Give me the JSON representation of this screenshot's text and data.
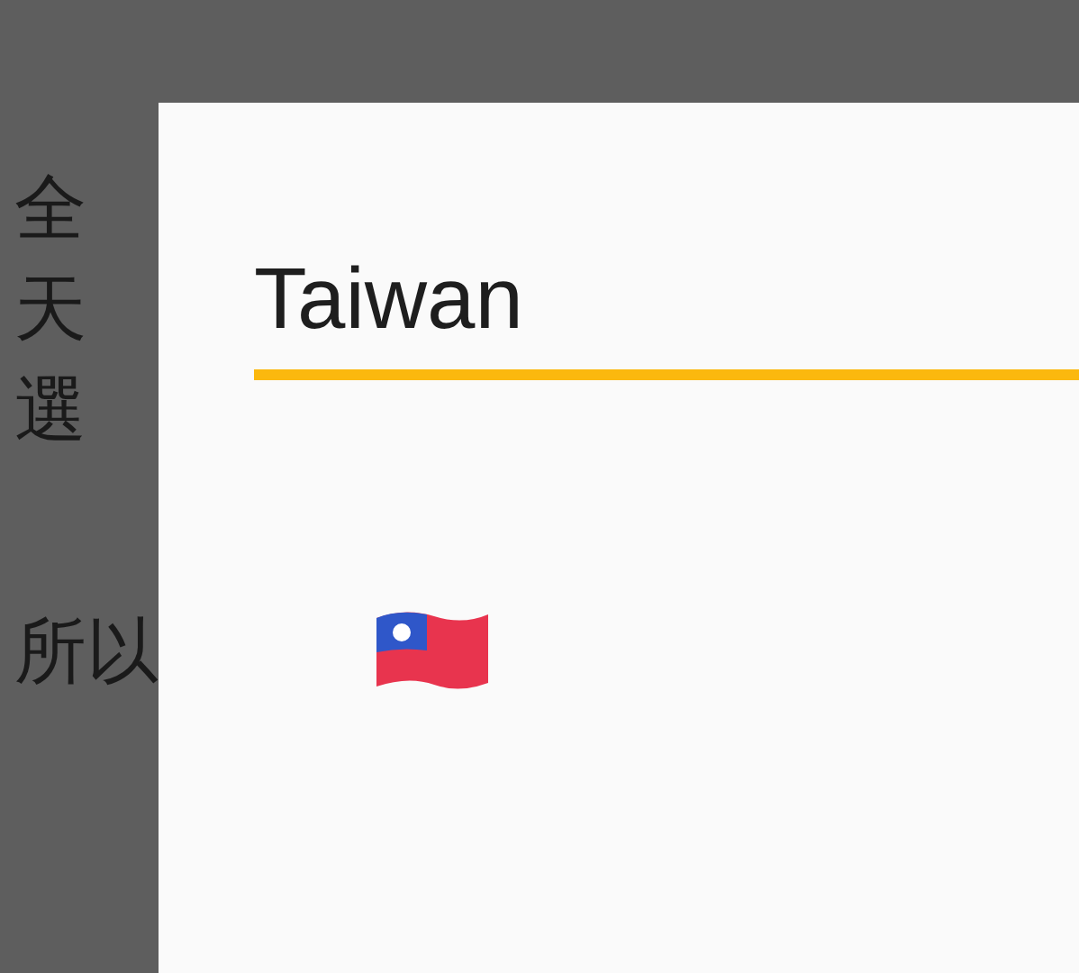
{
  "background_paragraphs": [
    {
      "lines": [
        "全",
        "天",
        "選"
      ]
    },
    {
      "lines": [
        "所以"
      ]
    }
  ],
  "dialog": {
    "title": "Taiwan"
  }
}
